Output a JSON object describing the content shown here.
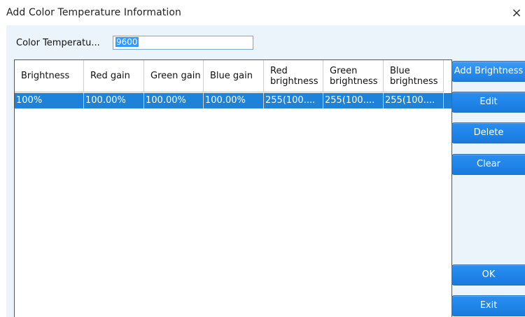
{
  "window": {
    "title": "Add Color Temperature Information",
    "close_glyph": "×"
  },
  "temperature": {
    "label": "Color Temperatu...",
    "value": "9600"
  },
  "table": {
    "headers": [
      "Brightness",
      "Red gain",
      "Green gain",
      "Blue gain",
      "Red brightness",
      "Green brightness",
      "Blue brightness"
    ],
    "rows": [
      [
        "100%",
        "100.00%",
        "100.00%",
        "100.00%",
        "255(100....",
        "255(100....",
        "255(100...."
      ]
    ],
    "selected_row_color": "#1e82d8"
  },
  "buttons": {
    "add_brightness": "Add Brightness",
    "edit": "Edit",
    "delete": "Delete",
    "clear": "Clear",
    "ok": "OK",
    "exit": "Exit"
  },
  "colors": {
    "button_blue": "#2a8ef0",
    "client_background": "#ecf4fb"
  }
}
